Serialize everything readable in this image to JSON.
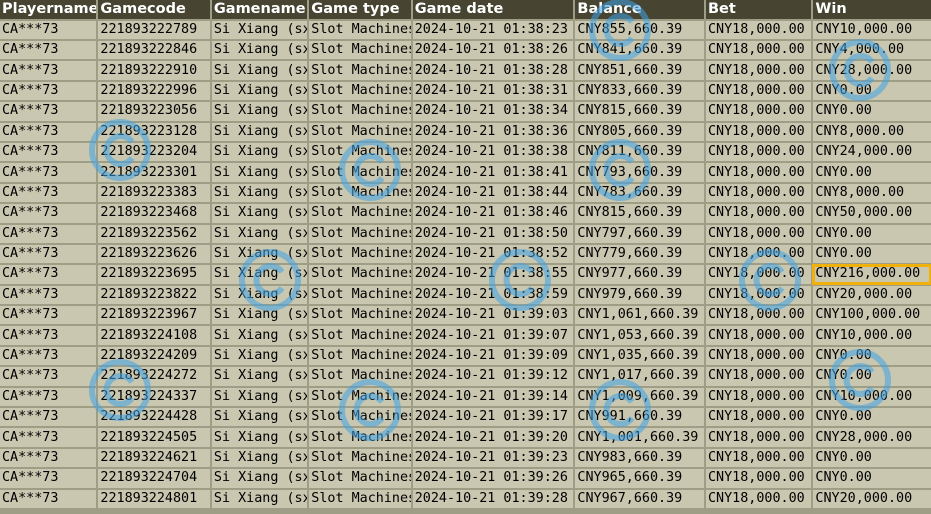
{
  "columns": [
    "Playername",
    "Gamecode",
    "Gamename",
    "Game type",
    "Game date",
    "Balance",
    "Bet",
    "Win"
  ],
  "rows": [
    [
      "CA***73",
      "221893222789",
      "Si Xiang (sx)",
      "Slot Machines",
      "2024-10-21 01:38:23",
      "CNY855,660.39",
      "CNY18,000.00",
      "CNY10,000.00"
    ],
    [
      "CA***73",
      "221893222846",
      "Si Xiang (sx)",
      "Slot Machines",
      "2024-10-21 01:38:26",
      "CNY841,660.39",
      "CNY18,000.00",
      "CNY4,000.00"
    ],
    [
      "CA***73",
      "221893222910",
      "Si Xiang (sx)",
      "Slot Machines",
      "2024-10-21 01:38:28",
      "CNY851,660.39",
      "CNY18,000.00",
      "CNY28,000.00"
    ],
    [
      "CA***73",
      "221893222996",
      "Si Xiang (sx)",
      "Slot Machines",
      "2024-10-21 01:38:31",
      "CNY833,660.39",
      "CNY18,000.00",
      "CNY0.00"
    ],
    [
      "CA***73",
      "221893223056",
      "Si Xiang (sx)",
      "Slot Machines",
      "2024-10-21 01:38:34",
      "CNY815,660.39",
      "CNY18,000.00",
      "CNY0.00"
    ],
    [
      "CA***73",
      "221893223128",
      "Si Xiang (sx)",
      "Slot Machines",
      "2024-10-21 01:38:36",
      "CNY805,660.39",
      "CNY18,000.00",
      "CNY8,000.00"
    ],
    [
      "CA***73",
      "221893223204",
      "Si Xiang (sx)",
      "Slot Machines",
      "2024-10-21 01:38:38",
      "CNY811,660.39",
      "CNY18,000.00",
      "CNY24,000.00"
    ],
    [
      "CA***73",
      "221893223301",
      "Si Xiang (sx)",
      "Slot Machines",
      "2024-10-21 01:38:41",
      "CNY793,660.39",
      "CNY18,000.00",
      "CNY0.00"
    ],
    [
      "CA***73",
      "221893223383",
      "Si Xiang (sx)",
      "Slot Machines",
      "2024-10-21 01:38:44",
      "CNY783,660.39",
      "CNY18,000.00",
      "CNY8,000.00"
    ],
    [
      "CA***73",
      "221893223468",
      "Si Xiang (sx)",
      "Slot Machines",
      "2024-10-21 01:38:46",
      "CNY815,660.39",
      "CNY18,000.00",
      "CNY50,000.00"
    ],
    [
      "CA***73",
      "221893223562",
      "Si Xiang (sx)",
      "Slot Machines",
      "2024-10-21 01:38:50",
      "CNY797,660.39",
      "CNY18,000.00",
      "CNY0.00"
    ],
    [
      "CA***73",
      "221893223626",
      "Si Xiang (sx)",
      "Slot Machines",
      "2024-10-21 01:38:52",
      "CNY779,660.39",
      "CNY18,000.00",
      "CNY0.00"
    ],
    [
      "CA***73",
      "221893223695",
      "Si Xiang (sx)",
      "Slot Machines",
      "2024-10-21 01:38:55",
      "CNY977,660.39",
      "CNY18,000.00",
      "CNY216,000.00"
    ],
    [
      "CA***73",
      "221893223822",
      "Si Xiang (sx)",
      "Slot Machines",
      "2024-10-21 01:38:59",
      "CNY979,660.39",
      "CNY18,000.00",
      "CNY20,000.00"
    ],
    [
      "CA***73",
      "221893223967",
      "Si Xiang (sx)",
      "Slot Machines",
      "2024-10-21 01:39:03",
      "CNY1,061,660.39",
      "CNY18,000.00",
      "CNY100,000.00"
    ],
    [
      "CA***73",
      "221893224108",
      "Si Xiang (sx)",
      "Slot Machines",
      "2024-10-21 01:39:07",
      "CNY1,053,660.39",
      "CNY18,000.00",
      "CNY10,000.00"
    ],
    [
      "CA***73",
      "221893224209",
      "Si Xiang (sx)",
      "Slot Machines",
      "2024-10-21 01:39:09",
      "CNY1,035,660.39",
      "CNY18,000.00",
      "CNY0.00"
    ],
    [
      "CA***73",
      "221893224272",
      "Si Xiang (sx)",
      "Slot Machines",
      "2024-10-21 01:39:12",
      "CNY1,017,660.39",
      "CNY18,000.00",
      "CNY0.00"
    ],
    [
      "CA***73",
      "221893224337",
      "Si Xiang (sx)",
      "Slot Machines",
      "2024-10-21 01:39:14",
      "CNY1,009,660.39",
      "CNY18,000.00",
      "CNY10,000.00"
    ],
    [
      "CA***73",
      "221893224428",
      "Si Xiang (sx)",
      "Slot Machines",
      "2024-10-21 01:39:17",
      "CNY991,660.39",
      "CNY18,000.00",
      "CNY0.00"
    ],
    [
      "CA***73",
      "221893224505",
      "Si Xiang (sx)",
      "Slot Machines",
      "2024-10-21 01:39:20",
      "CNY1,001,660.39",
      "CNY18,000.00",
      "CNY28,000.00"
    ],
    [
      "CA***73",
      "221893224621",
      "Si Xiang (sx)",
      "Slot Machines",
      "2024-10-21 01:39:23",
      "CNY983,660.39",
      "CNY18,000.00",
      "CNY0.00"
    ],
    [
      "CA***73",
      "221893224704",
      "Si Xiang (sx)",
      "Slot Machines",
      "2024-10-21 01:39:26",
      "CNY965,660.39",
      "CNY18,000.00",
      "CNY0.00"
    ],
    [
      "CA***73",
      "221893224801",
      "Si Xiang (sx)",
      "Slot Machines",
      "2024-10-21 01:39:28",
      "CNY967,660.39",
      "CNY18,000.00",
      "CNY20,000.00"
    ]
  ],
  "highlighted_row": 12,
  "highlighted_column": 7,
  "colors": {
    "header_bg": "#474531",
    "header_text": "#ffffff",
    "cell_bg": "#c9c7b0",
    "grid_bg": "#9e9d86",
    "highlight_border": "#f2b10a",
    "watermark": "#3fa2e6"
  }
}
